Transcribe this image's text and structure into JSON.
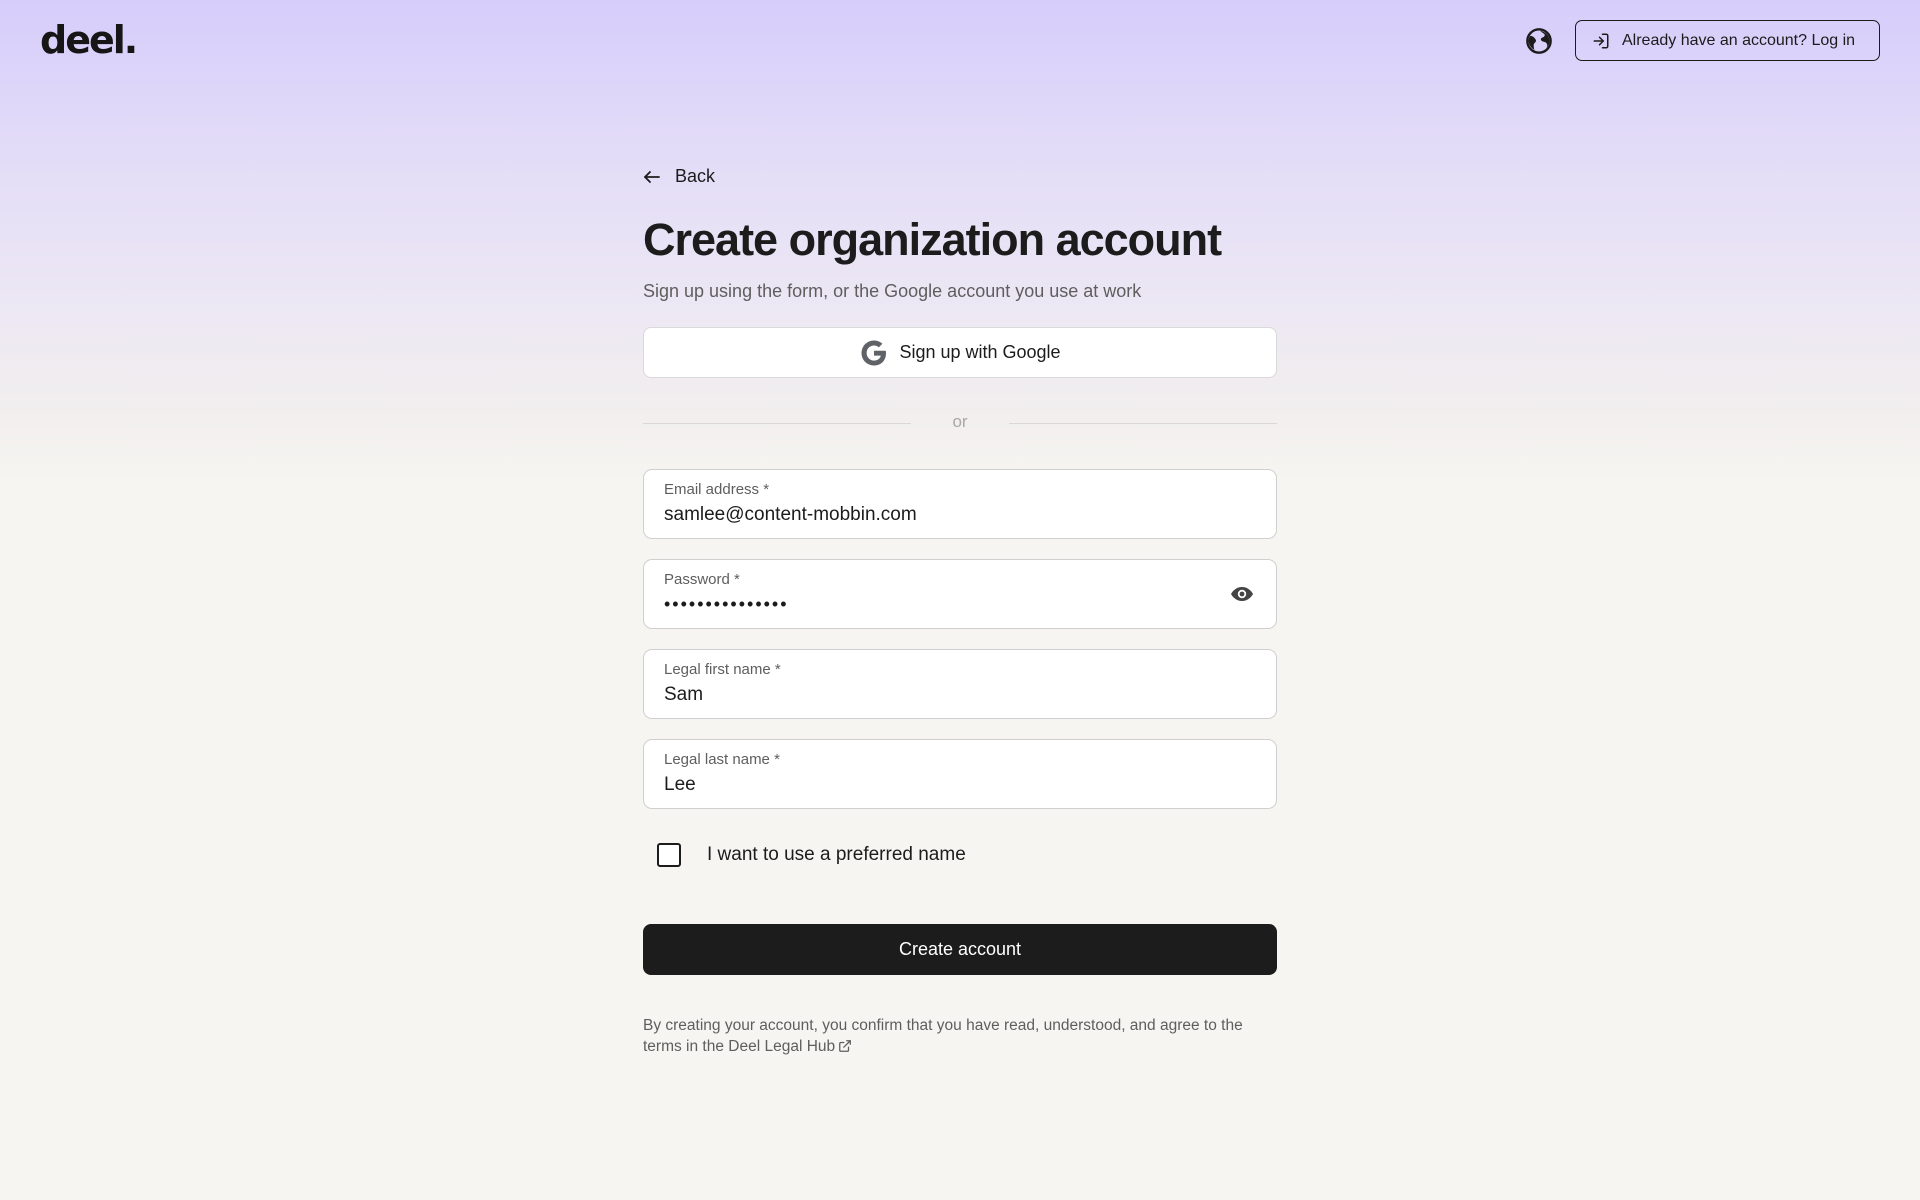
{
  "header": {
    "logo": "deel.",
    "language_icon": "globe-icon",
    "login_icon": "login-icon",
    "login_label": "Already have an account? Log in"
  },
  "form": {
    "back_label": "Back",
    "back_icon": "arrow-left-icon",
    "title": "Create organization account",
    "subtitle": "Sign up using the form, or the Google account you use at work",
    "google_label": "Sign up with Google",
    "google_icon": "google-icon",
    "divider_text": "or",
    "email": {
      "label": "Email address *",
      "value": "samlee@content-mobbin.com"
    },
    "password": {
      "label": "Password *",
      "value": "•••••••••••••••",
      "toggle_icon": "eye-icon"
    },
    "first_name": {
      "label": "Legal first name *",
      "value": "Sam"
    },
    "last_name": {
      "label": "Legal last name *",
      "value": "Lee"
    },
    "preferred_name_label": "I want to use a preferred name",
    "preferred_name_checked": false,
    "submit_label": "Create account",
    "legal_text": "By creating your account, you confirm that you have read, understood, and agree to the terms in the",
    "legal_link": "Deel Legal Hub",
    "legal_link_icon": "external-link-icon"
  },
  "colors": {
    "primary": "#1c1c1c",
    "background_top": "#d6cdfb",
    "background_bottom": "#f6f5f1",
    "muted_text": "#5e5e5e"
  }
}
